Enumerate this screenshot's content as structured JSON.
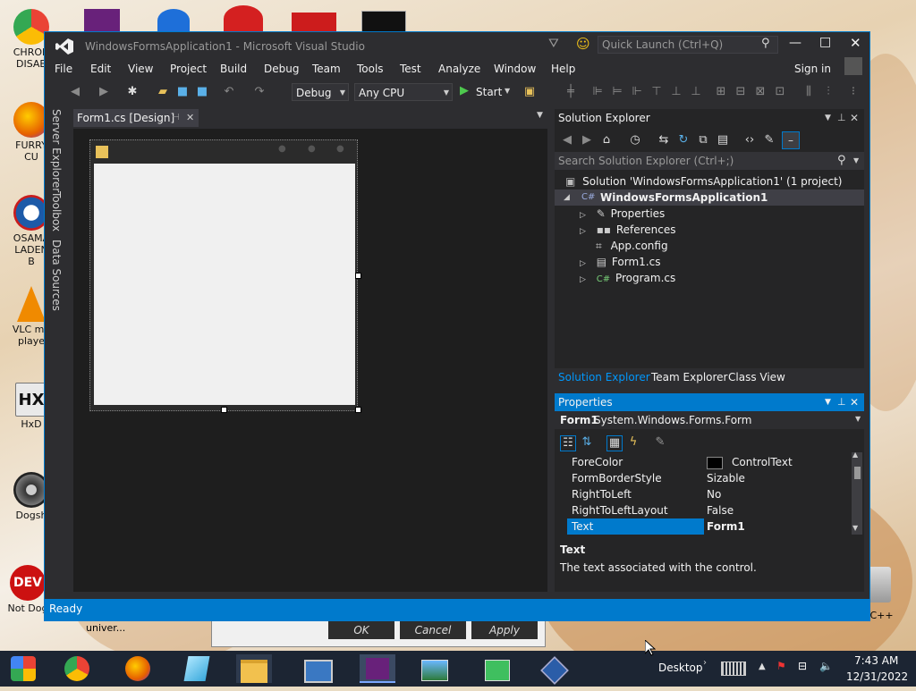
{
  "desktop": {
    "icons": [
      {
        "label": "CHRON\nDISAB",
        "color": "#1a73e8"
      },
      {
        "label": "FURRY CU",
        "color": "#e66000"
      },
      {
        "label": "OSAMA\nLADEN B",
        "color": "#1c5aa8"
      },
      {
        "label": "VLC me\nplaye",
        "color": "#f08a00"
      },
      {
        "label": "HxD",
        "color": "#3a3a3a"
      },
      {
        "label": "Dogsh",
        "color": "#555555"
      },
      {
        "label": "Not Dog",
        "color": "#cc1111"
      }
    ],
    "right_icon_label": "n C++",
    "behind_text": "univer..."
  },
  "vs": {
    "title": "WindowsFormsApplication1 - Microsoft Visual Studio",
    "quick_launch_placeholder": "Quick Launch (Ctrl+Q)",
    "sign_in": "Sign in",
    "menu": [
      "File",
      "Edit",
      "View",
      "Project",
      "Build",
      "Debug",
      "Team",
      "Tools",
      "Test",
      "Analyze",
      "Window",
      "Help"
    ],
    "toolbar": {
      "config": "Debug",
      "platform": "Any CPU",
      "start": "Start"
    },
    "side_tabs": [
      "Server Explorer",
      "Toolbox",
      "Data Sources"
    ],
    "doc_tab": "Form1.cs [Design]",
    "solution_explorer": {
      "title": "Solution Explorer",
      "search_placeholder": "Search Solution Explorer (Ctrl+;)",
      "solution": "Solution 'WindowsFormsApplication1' (1 project)",
      "project": "WindowsFormsApplication1",
      "items": [
        "Properties",
        "References",
        "App.config",
        "Form1.cs",
        "Program.cs"
      ],
      "bottom_tabs": [
        "Solution Explorer",
        "Team Explorer",
        "Class View"
      ]
    },
    "properties": {
      "title": "Properties",
      "object_name": "Form1",
      "object_type": "System.Windows.Forms.Form",
      "rows": [
        {
          "name": "ForeColor",
          "value": "ControlText"
        },
        {
          "name": "FormBorderStyle",
          "value": "Sizable"
        },
        {
          "name": "RightToLeft",
          "value": "No"
        },
        {
          "name": "RightToLeftLayout",
          "value": "False"
        },
        {
          "name": "Text",
          "value": "Form1"
        }
      ],
      "desc_title": "Text",
      "desc_body": "The text associated with the control."
    },
    "status": "Ready"
  },
  "dialog": {
    "ok": "OK",
    "cancel": "Cancel",
    "apply": "Apply"
  },
  "taskbar": {
    "desktop_label": "Desktop",
    "time": "7:43 AM",
    "date": "12/31/2022"
  },
  "colors": {
    "accent": "#007acc",
    "vs_bg": "#2d2d30",
    "taskbar": "#1c2533"
  }
}
